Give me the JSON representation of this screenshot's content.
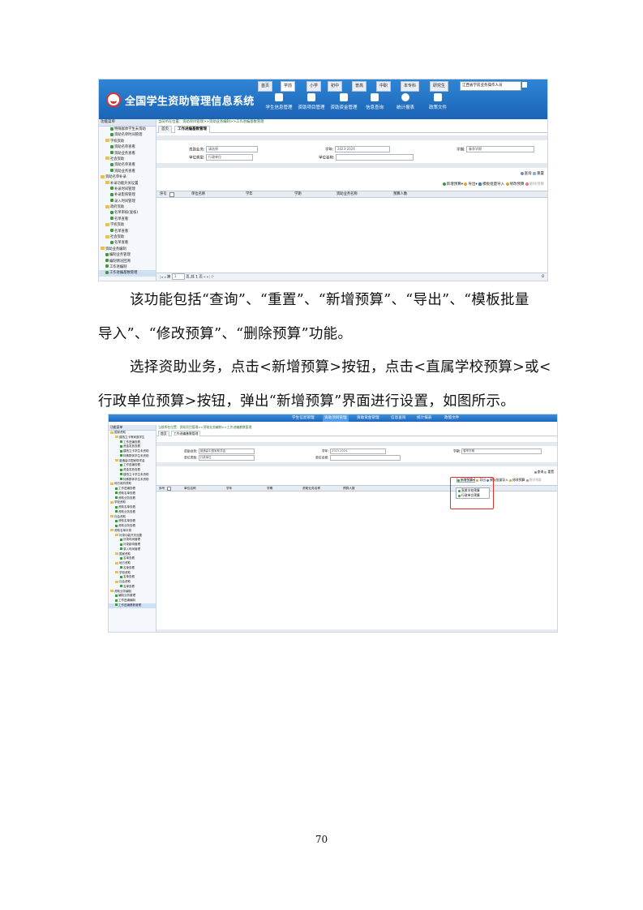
{
  "screenshot1": {
    "app_title": "全国学生资助管理信息系统",
    "top_tabs": [
      {
        "label": "首页",
        "active": false
      },
      {
        "label": "学前",
        "active": true
      },
      {
        "label": "小学",
        "active": false
      },
      {
        "label": "初中",
        "active": false
      },
      {
        "label": "普高",
        "active": false
      },
      {
        "label": "中职",
        "active": false
      },
      {
        "label": "本专科",
        "active": false
      },
      {
        "label": "研究生",
        "active": false
      }
    ],
    "province_select": "江西省学前业务操作人员",
    "nav_buttons": [
      "学生信息管理",
      "资助项目管理",
      "资助资金管理",
      "信息查询",
      "统计报表",
      "政策文件"
    ],
    "sidebar_header": "功能菜单",
    "sidebar_items": [
      {
        "label": "特殊群体学生未资助",
        "level": 2,
        "kind": "leaf"
      },
      {
        "label": "资助名单时间管理",
        "level": 2,
        "kind": "leaf"
      },
      {
        "label": "学校资助",
        "level": 1,
        "kind": "folder"
      },
      {
        "label": "资助名单查看",
        "level": 2,
        "kind": "leaf"
      },
      {
        "label": "资助业务查看",
        "level": 2,
        "kind": "leaf"
      },
      {
        "label": "社会资助",
        "level": 1,
        "kind": "folder"
      },
      {
        "label": "资助名单查看",
        "level": 2,
        "kind": "leaf"
      },
      {
        "label": "资助业务查看",
        "level": 2,
        "kind": "leaf"
      },
      {
        "label": "资助名单补录",
        "level": 0,
        "kind": "folder"
      },
      {
        "label": "补录功能开关设置",
        "level": 1,
        "kind": "folder"
      },
      {
        "label": "补录时间管理",
        "level": 2,
        "kind": "leaf"
      },
      {
        "label": "补录影响管理",
        "level": 2,
        "kind": "leaf"
      },
      {
        "label": "录入时间管理",
        "level": 2,
        "kind": "leaf"
      },
      {
        "label": "政府资助",
        "level": 1,
        "kind": "folder"
      },
      {
        "label": "名单审核(复核)",
        "level": 2,
        "kind": "leaf"
      },
      {
        "label": "名单查看",
        "level": 2,
        "kind": "leaf"
      },
      {
        "label": "学校资助",
        "level": 1,
        "kind": "folder"
      },
      {
        "label": "名单查看",
        "level": 2,
        "kind": "leaf"
      },
      {
        "label": "社会资助",
        "level": 1,
        "kind": "folder"
      },
      {
        "label": "名单查看",
        "level": 2,
        "kind": "leaf"
      },
      {
        "label": "资助业务编制",
        "level": 0,
        "kind": "folder"
      },
      {
        "label": "编制业务管理",
        "level": 1,
        "kind": "leaf"
      },
      {
        "label": "编制情况回溯",
        "level": 1,
        "kind": "leaf"
      },
      {
        "label": "工作进编制",
        "level": 1,
        "kind": "leaf"
      },
      {
        "label": "工作进编基数管理",
        "level": 1,
        "kind": "leaf",
        "selected": true
      }
    ],
    "breadcrumb": "当前所在位置：资助项目管理>>资助业务编制>>工作进编基数管理",
    "tabs": [
      {
        "label": "首页",
        "active": false
      },
      {
        "label": "工作进编基数管理",
        "active": true
      }
    ],
    "filters": {
      "business_label": "资助业务:",
      "business_value": "请选择",
      "year_label": "学年:",
      "year_value": "2023-2024",
      "term_label": "学期:",
      "term_value": "春季学期",
      "unit_type_label": "单位类型:",
      "unit_type_value": "行政单位",
      "unit_name_label": "单位名称:",
      "unit_name_value": ""
    },
    "query_buttons": [
      "查询",
      "重置"
    ],
    "actions": [
      "新增预算",
      "导出",
      "模板批量导入",
      "修改预算",
      "删除预算"
    ],
    "columns": [
      "序号",
      "单位名称",
      "学年",
      "学期",
      "资助业务名称",
      "预算人数"
    ],
    "pager": {
      "page_label": "第",
      "page_value": "1",
      "total_label": "页,共 1 页"
    },
    "pager_count": "0"
  },
  "paragraphs": [
    "该功能包括“查询”、“重置”、“新增预算”、“导出”、“模板批量",
    "导入”、“修改预算”、“删除预算”功能。",
    "选择资助业务，点击<新增预算>按钮，点击<直属学校预算>或<",
    "行政单位预算>按钮，弹出“新增预算”界面进行设置，如图所示。"
  ],
  "screenshot2": {
    "nav": [
      "学生信息管理",
      "资助项目管理",
      "资助资金管理",
      "信息查询",
      "统计报表",
      "政策文件"
    ],
    "sidebar_header": "功能菜单",
    "sidebar_items": [
      {
        "label": "国家资助",
        "level": 0,
        "kind": "folder"
      },
      {
        "label": "建档立卡等家庭学生",
        "level": 1,
        "kind": "folder"
      },
      {
        "label": "工作进编查看",
        "level": 2,
        "kind": "leaf"
      },
      {
        "label": "资金发放查看",
        "level": 2,
        "kind": "leaf"
      },
      {
        "label": "建档立卡学生未资助",
        "level": 2,
        "kind": "leaf"
      },
      {
        "label": "特殊群体学生未资助",
        "level": 2,
        "kind": "leaf"
      },
      {
        "label": "普通高中国家助学金",
        "level": 1,
        "kind": "folder"
      },
      {
        "label": "工作进编查看",
        "level": 2,
        "kind": "leaf"
      },
      {
        "label": "资金发放查看",
        "level": 2,
        "kind": "leaf"
      },
      {
        "label": "建档立卡学生未资助",
        "level": 2,
        "kind": "leaf"
      },
      {
        "label": "特殊群体学生未资助",
        "level": 2,
        "kind": "leaf"
      },
      {
        "label": "地方政府资助",
        "level": 0,
        "kind": "folder"
      },
      {
        "label": "工作进编查看",
        "level": 1,
        "kind": "leaf"
      },
      {
        "label": "资助名单查看",
        "level": 1,
        "kind": "leaf"
      },
      {
        "label": "资助业务查看",
        "level": 1,
        "kind": "leaf"
      },
      {
        "label": "学校资助",
        "level": 0,
        "kind": "folder"
      },
      {
        "label": "资助名单查看",
        "level": 1,
        "kind": "leaf"
      },
      {
        "label": "资助业务查看",
        "level": 1,
        "kind": "leaf"
      },
      {
        "label": "社会资助",
        "level": 0,
        "kind": "folder"
      },
      {
        "label": "资助名单查看",
        "level": 1,
        "kind": "leaf"
      },
      {
        "label": "资助业务查看",
        "level": 1,
        "kind": "leaf"
      },
      {
        "label": "资助名单补录",
        "level": 0,
        "kind": "folder"
      },
      {
        "label": "补录功能开关设置",
        "level": 1,
        "kind": "folder"
      },
      {
        "label": "补录时间管理",
        "level": 2,
        "kind": "leaf"
      },
      {
        "label": "补录影响管理",
        "level": 2,
        "kind": "leaf"
      },
      {
        "label": "录入时间管理",
        "level": 2,
        "kind": "leaf"
      },
      {
        "label": "国家资助",
        "level": 1,
        "kind": "folder"
      },
      {
        "label": "名单查看",
        "level": 2,
        "kind": "leaf"
      },
      {
        "label": "地方资助",
        "level": 1,
        "kind": "folder"
      },
      {
        "label": "名单查看",
        "level": 2,
        "kind": "leaf"
      },
      {
        "label": "学校资助",
        "level": 1,
        "kind": "folder"
      },
      {
        "label": "名单查看",
        "level": 2,
        "kind": "leaf"
      },
      {
        "label": "社会资助",
        "level": 1,
        "kind": "folder"
      },
      {
        "label": "名单查看",
        "level": 2,
        "kind": "leaf"
      },
      {
        "label": "资助业务编制",
        "level": 0,
        "kind": "folder"
      },
      {
        "label": "编制业务管理",
        "level": 1,
        "kind": "leaf"
      },
      {
        "label": "工作进编编制",
        "level": 1,
        "kind": "leaf"
      },
      {
        "label": "工作进编基数管理",
        "level": 1,
        "kind": "leaf",
        "selected": true
      }
    ],
    "breadcrumb": "当前所在位置：资助项目管理>>资助业务编制>>工作进编基数管理",
    "tabs": [
      {
        "label": "首页",
        "active": false
      },
      {
        "label": "工作进编基数管理",
        "active": true
      }
    ],
    "filters": {
      "business_label": "资助业务:",
      "business_value": "普通高中国家助学金",
      "year_label": "学年:",
      "year_value": "2023-2024",
      "term_label": "学期:",
      "term_value": "春季学期",
      "unit_type_label": "单位类型:",
      "unit_type_value": "行政单位",
      "unit_name_label": "单位名称:",
      "unit_name_value": ""
    },
    "query_buttons": [
      "查询",
      "重置"
    ],
    "actions": [
      "新增预算",
      "导出",
      "模板批量导入",
      "修改预算",
      "删除预算"
    ],
    "dropdown": [
      "直属学校预算",
      "行政单位预算"
    ],
    "columns": [
      "序号",
      "单位名称",
      "学年",
      "学期",
      "资助业务名称",
      "预算人数"
    ]
  },
  "page_number": "70"
}
